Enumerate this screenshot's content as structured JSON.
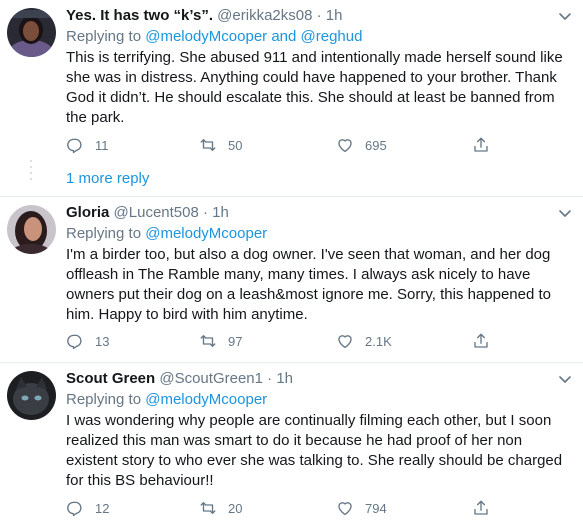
{
  "tweets": [
    {
      "name": "Yes. It has two “k’s”.",
      "handle": "@erikka2ks08",
      "sep": "·",
      "time": "1h",
      "replying_label": "Replying to",
      "replying_to": "@melodyMcooper and @reghud",
      "text": "This is terrifying. She abused 911 and intentionally made herself sound like she was in distress. Anything could have happened to your brother. Thank God it didn’t. He should escalate this. She should at least be banned from the park.",
      "replies": "11",
      "retweets": "50",
      "likes": "695"
    },
    {
      "name": "Gloria",
      "handle": "@Lucent508",
      "sep": "·",
      "time": "1h",
      "replying_label": "Replying to",
      "replying_to": "@melodyMcooper",
      "text": "I'm a birder too, but also a dog owner.  I've seen that woman, and her dog offleash in The Ramble many, many times.  I always ask nicely to have owners put their dog on a leash&most ignore me. Sorry, this happened to him.  Happy to bird with him anytime.",
      "replies": "13",
      "retweets": "97",
      "likes": "2.1K"
    },
    {
      "name": "Scout Green",
      "handle": "@ScoutGreen1",
      "sep": "·",
      "time": "1h",
      "replying_label": "Replying to",
      "replying_to": "@melodyMcooper",
      "text": "I was wondering why people are continually filming each other, but I soon realized this man was smart to do it because he had proof of her non existent story to who ever she was talking to.  She really should be charged for this BS behaviour!!",
      "replies": "12",
      "retweets": "20",
      "likes": "794"
    }
  ],
  "thread": {
    "more_replies": "1 more reply"
  },
  "colors": {
    "link": "#1b95e0",
    "muted": "#657786",
    "text": "#14171a",
    "divider": "#e6ecf0"
  }
}
